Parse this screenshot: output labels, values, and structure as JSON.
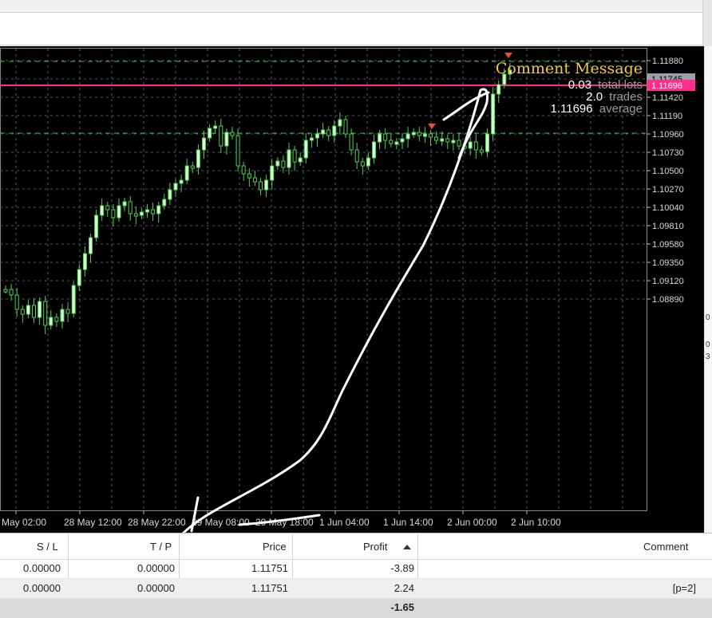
{
  "chart": {
    "price_axis": [
      "1.11880",
      "1.11650",
      "1.11420",
      "1.11190",
      "1.10960",
      "1.10730",
      "1.10500",
      "1.10270",
      "1.10040",
      "1.09810",
      "1.09580",
      "1.09350",
      "1.09120",
      "1.08890"
    ],
    "current_price_tag": "1.11745",
    "average_price_tag": "1.11696",
    "time_axis": [
      "May 02:00",
      "28 May 12:00",
      "28 May 22:00",
      "29 May 08:00",
      "29 May 18:00",
      "1 Jun 04:00",
      "1 Jun 14:00",
      "2 Jun 00:00",
      "2 Jun 10:00"
    ],
    "comment": {
      "title": "Comment Message",
      "lots_value": "0.03",
      "lots_label": "total lots",
      "trades_value": "2.0",
      "trades_label": "trades",
      "avg_value": "1.11696",
      "avg_label": "average"
    },
    "colors": {
      "background": "#000000",
      "grid": "#4c5a6a",
      "bull_candle": "#d6ffd6",
      "bear_candle": "#000000",
      "wick": "#52d052",
      "avg_line": "#ff2e8a",
      "level_line": "#3cbf3c",
      "comment_title": "#f2c84b",
      "label_gray": "#9a9a9a",
      "sell_arrow": "#e0523a",
      "annotation": "#ffffff"
    }
  },
  "right_edge": {
    "marks": [
      "0",
      "0",
      "3"
    ]
  },
  "table": {
    "columns": [
      "S / L",
      "T / P",
      "Price",
      "Profit",
      "Comment"
    ],
    "sorted_column_icon": "sort-ascending-icon",
    "rows": [
      {
        "sl": "0.00000",
        "tp": "0.00000",
        "price": "1.11751",
        "profit": "-3.89",
        "comment": ""
      },
      {
        "sl": "0.00000",
        "tp": "0.00000",
        "price": "1.11751",
        "profit": "2.24",
        "comment": "[p=2]"
      }
    ],
    "total_profit": "-1.65"
  }
}
